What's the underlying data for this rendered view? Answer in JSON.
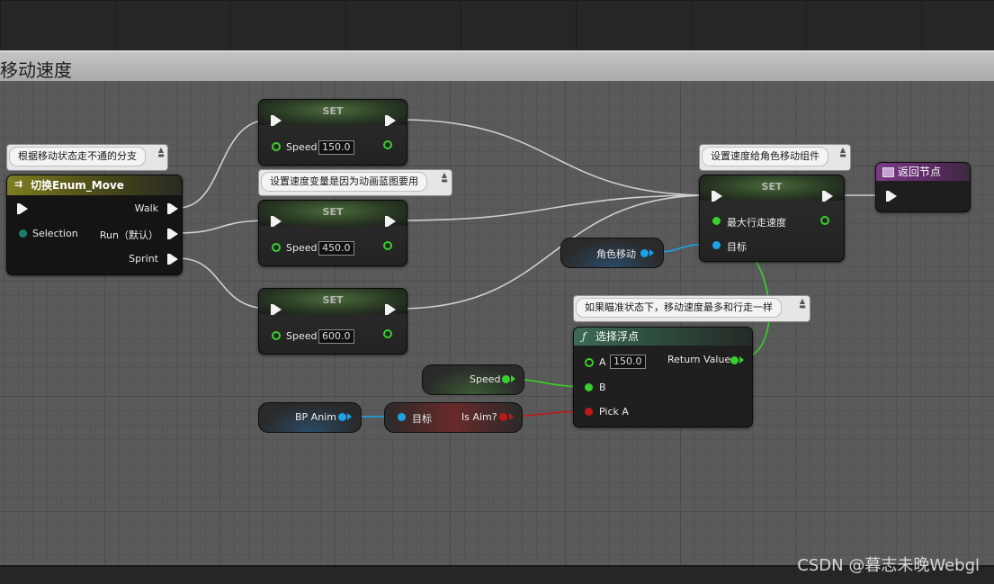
{
  "comment_box": {
    "title": "移动速度"
  },
  "comments": {
    "switch_note": "根据移动状态走不通的分支",
    "set_var_note": "设置速度变量是因为动画蓝图要用",
    "set_speed_note": "设置速度给角色移动组件",
    "select_note": "如果瞄准状态下，移动速度最多和行走一样"
  },
  "switch_node": {
    "title": "切换Enum_Move",
    "selection_pin": "Selection",
    "outputs": [
      "Walk",
      "Run（默认）",
      "Sprint"
    ]
  },
  "set_nodes": [
    {
      "title": "SET",
      "pin_label": "Speed",
      "value": "150.0"
    },
    {
      "title": "SET",
      "pin_label": "Speed",
      "value": "450.0"
    },
    {
      "title": "SET",
      "pin_label": "Speed",
      "value": "600.0"
    }
  ],
  "set_movement_node": {
    "title": "SET",
    "pin_max_speed": "最大行走速度",
    "pin_target": "目标"
  },
  "return_node": {
    "title": "返回节点"
  },
  "char_movement_var": {
    "label": "角色移动"
  },
  "speed_var": {
    "label": "Speed"
  },
  "bp_anim_var": {
    "label": "BP Anim"
  },
  "is_aim_node": {
    "target_label": "目标",
    "output_label": "Is Aim?"
  },
  "select_float_node": {
    "title": "选择浮点",
    "pin_a": "A",
    "pin_a_value": "150.0",
    "pin_b": "B",
    "pin_pick_a": "Pick A",
    "return_label": "Return Value"
  },
  "watermark": "CSDN @暮志未晚Webgl",
  "colors": {
    "exec_pin": "#f2f2f2",
    "float_pin": "#37d12b",
    "object_pin": "#1aa3e8",
    "bool_pin": "#c01818",
    "enum_pin": "#17806e"
  }
}
